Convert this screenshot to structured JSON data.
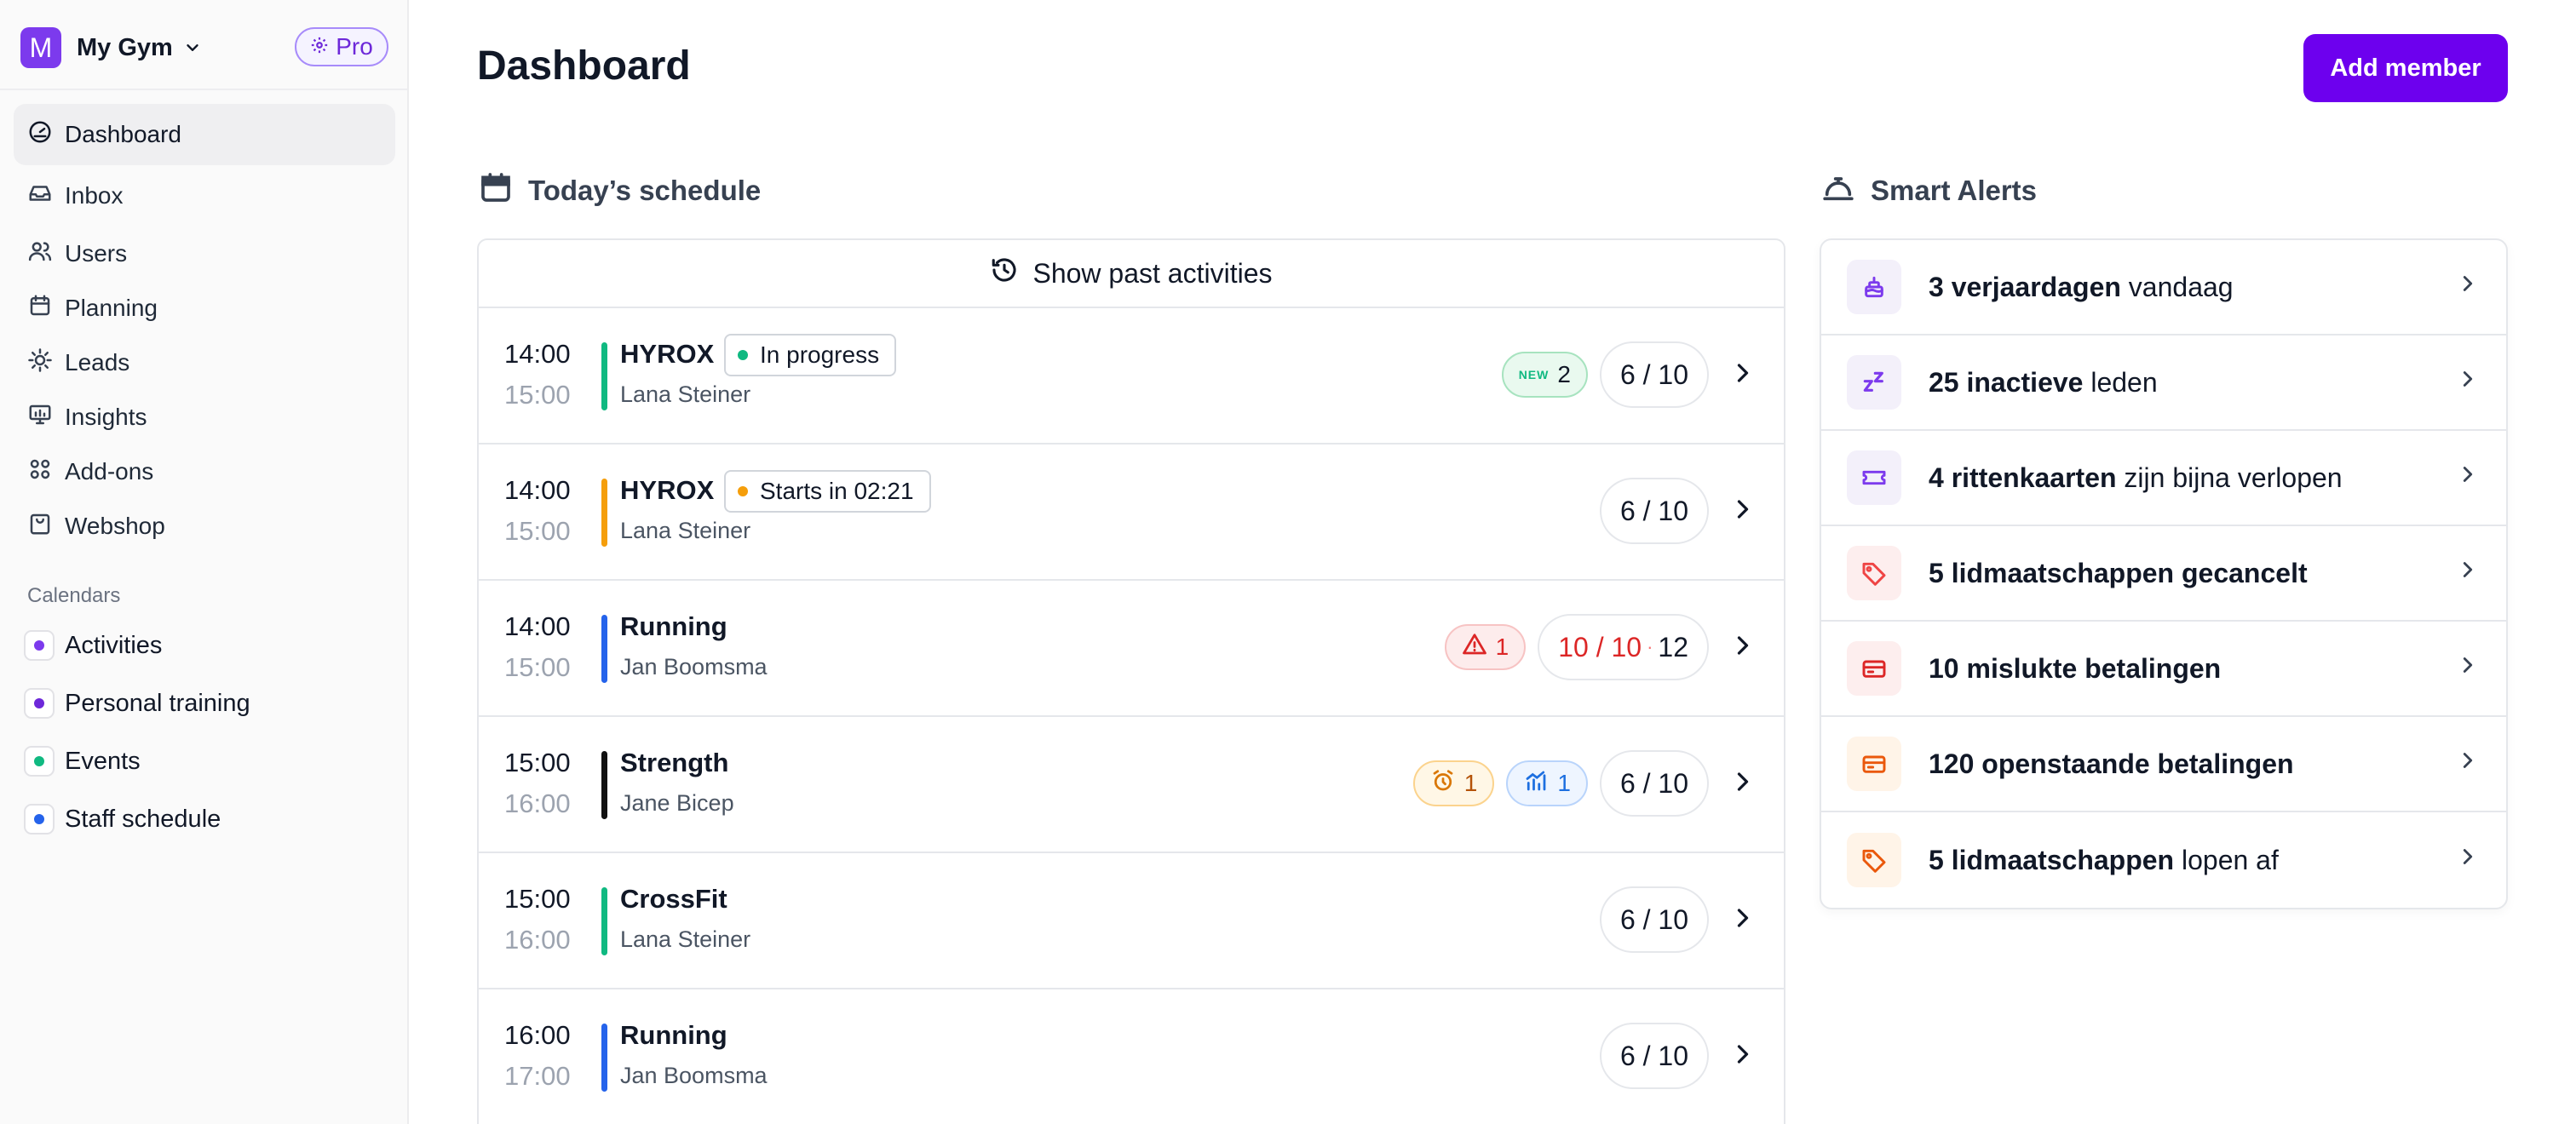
{
  "brand": {
    "logo_letter": "M",
    "name": "My Gym",
    "plan_badge": "Pro"
  },
  "nav": [
    {
      "label": "Dashboard",
      "icon": "gauge-icon",
      "active": true
    },
    {
      "label": "Inbox",
      "icon": "inbox-icon"
    },
    {
      "label": "Users",
      "icon": "users-icon"
    },
    {
      "label": "Planning",
      "icon": "calendar-icon"
    },
    {
      "label": "Leads",
      "icon": "target-icon"
    },
    {
      "label": "Insights",
      "icon": "presentation-chart-icon"
    },
    {
      "label": "Add-ons",
      "icon": "grid-icon"
    },
    {
      "label": "Webshop",
      "icon": "shopping-bag-icon"
    }
  ],
  "calendars": {
    "label": "Calendars",
    "items": [
      {
        "label": "Activities",
        "color": "#7c3aed"
      },
      {
        "label": "Personal training",
        "color": "#6d28d9"
      },
      {
        "label": "Events",
        "color": "#10b981"
      },
      {
        "label": "Staff schedule",
        "color": "#2563eb"
      }
    ]
  },
  "header": {
    "title": "Dashboard",
    "add_button": "Add member"
  },
  "schedule": {
    "title": "Today’s schedule",
    "past_label": "Show past activities",
    "activities": [
      {
        "start": "14:00",
        "end": "15:00",
        "name": "HYROX",
        "coach": "Lana Steiner",
        "color": "#10b981",
        "status": {
          "label": "In progress",
          "color": "#10b981"
        },
        "badges": [
          {
            "type": "new",
            "tag": "NEW",
            "count": "2"
          }
        ],
        "capacity": "6 / 10"
      },
      {
        "start": "14:00",
        "end": "15:00",
        "name": "HYROX",
        "coach": "Lana Steiner",
        "color": "#f59e0b",
        "status": {
          "label": "Starts in 02:21",
          "color": "#f59e0b"
        },
        "badges": [],
        "capacity": "6 / 10"
      },
      {
        "start": "14:00",
        "end": "15:00",
        "name": "Running",
        "coach": "Jan Boomsma",
        "color": "#2563eb",
        "badges": [
          {
            "type": "warn",
            "count": "1"
          }
        ],
        "capacity": "10 / 10",
        "waitlist": "12",
        "full": true
      },
      {
        "start": "15:00",
        "end": "16:00",
        "name": "Strength",
        "coach": "Jane Bicep",
        "color": "#111111",
        "badges": [
          {
            "type": "alarm",
            "count": "1"
          },
          {
            "type": "chart",
            "count": "1"
          }
        ],
        "capacity": "6 / 10"
      },
      {
        "start": "15:00",
        "end": "16:00",
        "name": "CrossFit",
        "coach": "Lana Steiner",
        "color": "#10b981",
        "badges": [],
        "capacity": "6 / 10"
      },
      {
        "start": "16:00",
        "end": "17:00",
        "name": "Running",
        "coach": "Jan Boomsma",
        "color": "#2563eb",
        "badges": [],
        "capacity": "6 / 10"
      }
    ]
  },
  "alerts": {
    "title": "Smart Alerts",
    "items": [
      {
        "bold": "3 verjaardagen",
        "rest": " vandaag",
        "icon": "cake-icon",
        "fg": "#7c3aed",
        "bg": "#f3f0fa"
      },
      {
        "bold": "25 inactieve",
        "rest": " leden",
        "icon": "sleep-icon",
        "fg": "#7c3aed",
        "bg": "#f3f0fa"
      },
      {
        "bold": "4 rittenkaarten",
        "rest": " zijn bijna verlopen",
        "icon": "ticket-icon",
        "fg": "#7c3aed",
        "bg": "#f3f0fa"
      },
      {
        "bold": "5 lidmaatschappen gecancelt",
        "rest": "",
        "icon": "tag-icon",
        "fg": "#ef4444",
        "bg": "#fdeeee"
      },
      {
        "bold": "10 mislukte betalingen",
        "rest": "",
        "icon": "credit-card-icon",
        "fg": "#dc2626",
        "bg": "#fdeeee"
      },
      {
        "bold": "120 openstaande betalingen",
        "rest": "",
        "icon": "credit-card-icon",
        "fg": "#ea580c",
        "bg": "#fff4e8"
      },
      {
        "bold": "5 lidmaatschappen",
        "rest": " lopen af",
        "icon": "tag-icon",
        "fg": "#ea580c",
        "bg": "#fff4e8"
      }
    ]
  }
}
